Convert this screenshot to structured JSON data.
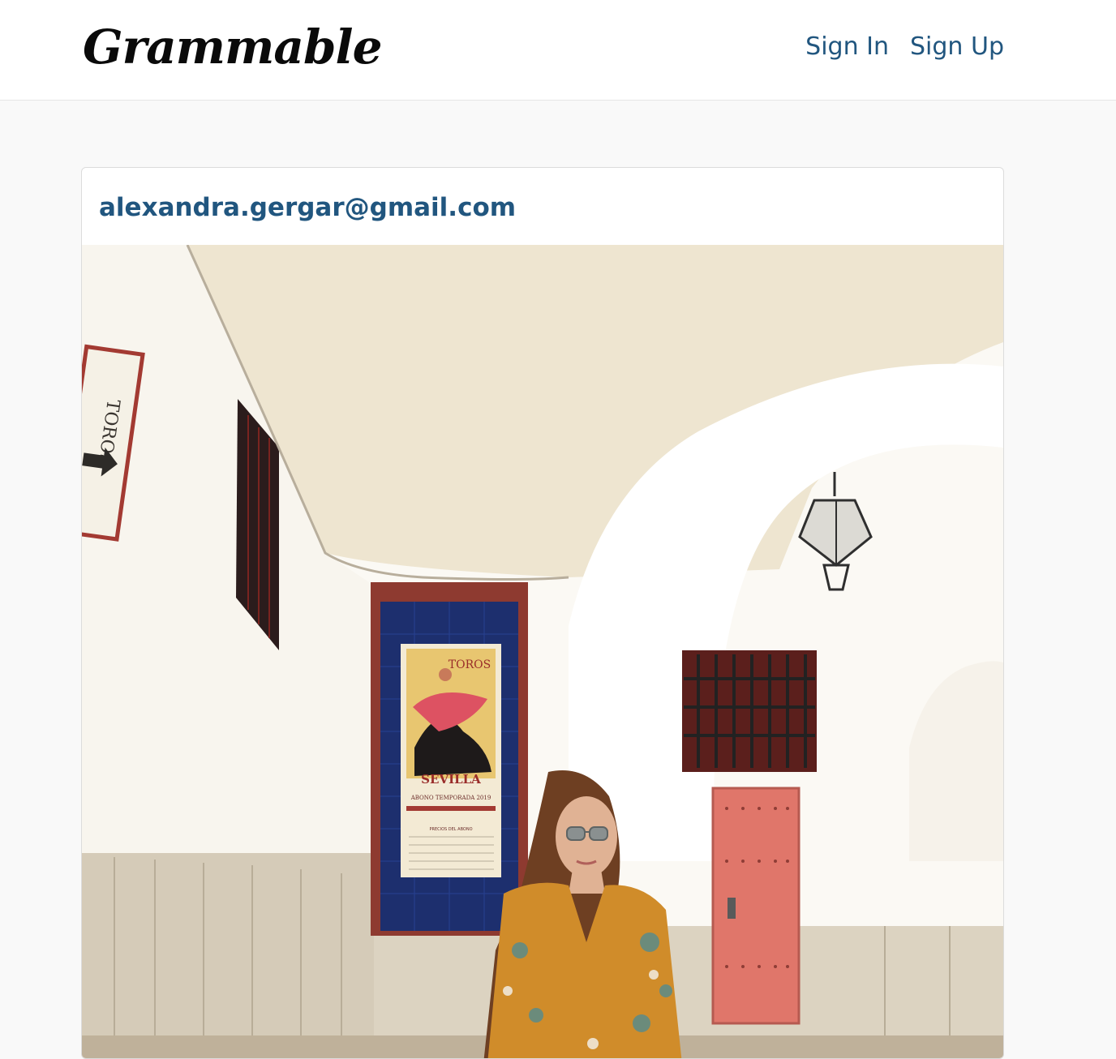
{
  "navbar": {
    "brand": "Grammable",
    "links": [
      {
        "label": "Sign In"
      },
      {
        "label": "Sign Up"
      }
    ]
  },
  "post": {
    "author_email": "alexandra.gergar@gmail.com",
    "photo": {
      "sign_text": "TOROS",
      "poster_title": "TOROS",
      "poster_city": "SEVILLA",
      "poster_subtitle": "ABONO TEMPORADA 2019",
      "poster_section": "PRECIOS DEL ABONO"
    }
  },
  "colors": {
    "link": "#21567f",
    "background": "#f9f9f9",
    "door": "#e0766a"
  }
}
